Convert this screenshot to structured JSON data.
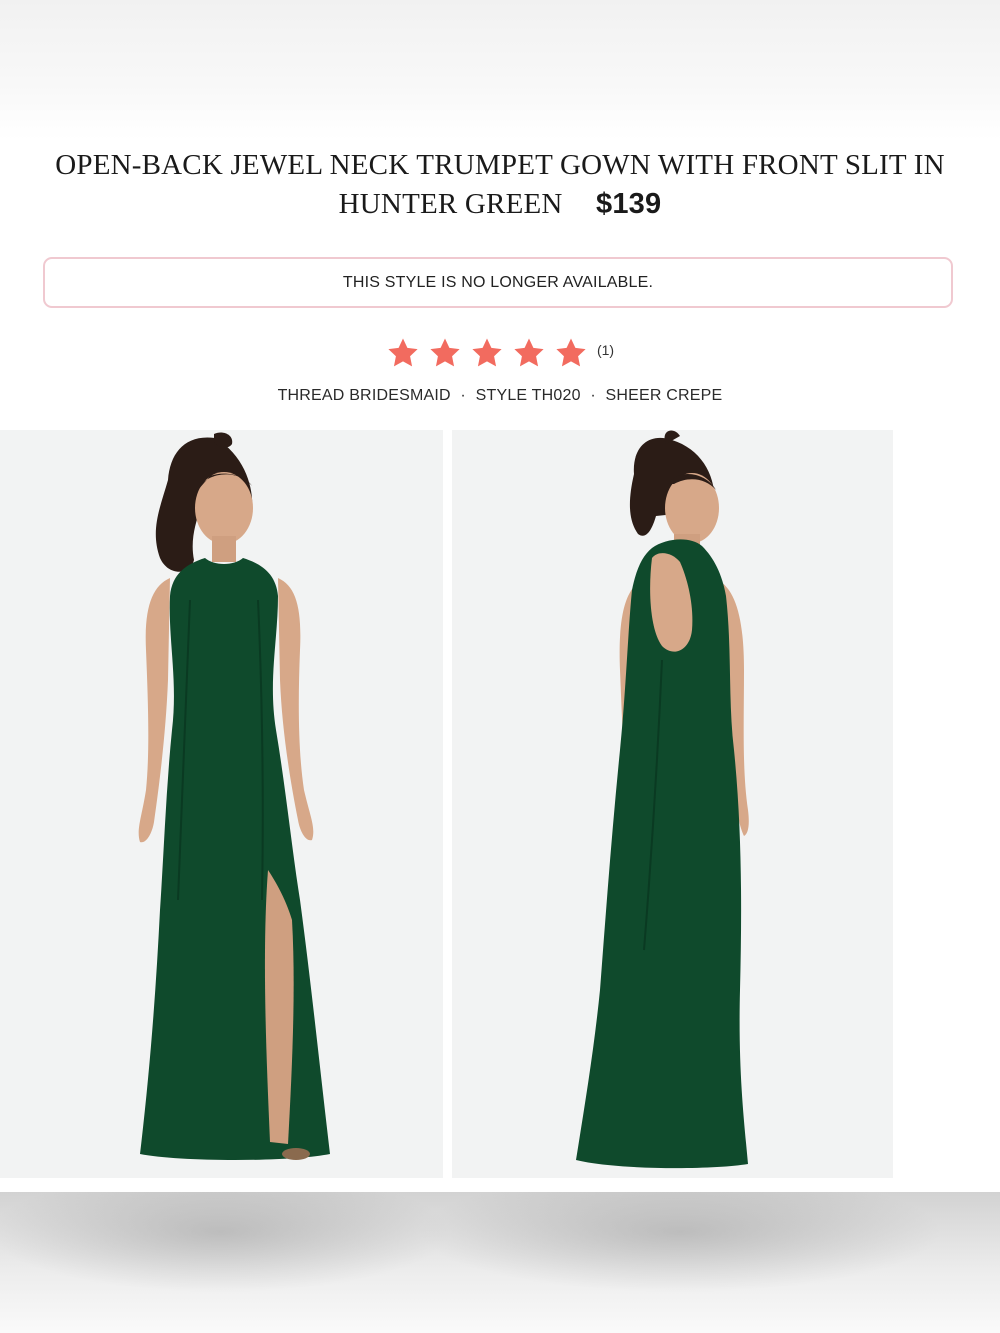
{
  "product": {
    "title": "OPEN-BACK JEWEL NECK TRUMPET GOWN WITH FRONT SLIT IN HUNTER GREEN",
    "price": "$139"
  },
  "availability": {
    "message": "THIS STYLE IS NO LONGER AVAILABLE."
  },
  "rating": {
    "stars": 5,
    "count_label": "(1)",
    "star_icon": "star-icon",
    "star_color": "#f26b5f"
  },
  "details": {
    "brand": "THREAD BRIDESMAID",
    "style": "STYLE TH020",
    "fabric": "SHEER CREPE",
    "separator": "·"
  },
  "colors": {
    "dress": "#0f4a2c",
    "notice_border": "#f0c9d0",
    "photo_background": "#f2f3f3"
  }
}
